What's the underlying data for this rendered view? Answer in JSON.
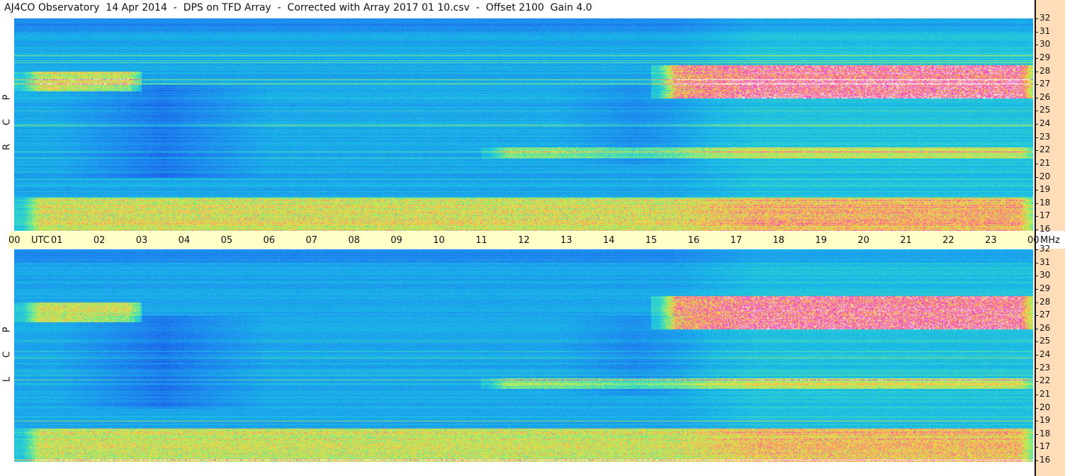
{
  "title": "AJ4CO Observatory  14 Apr 2014  -  DPS on TFD Array  -  Corrected with Array 2017 01 10.csv  -  Offset 2100  Gain 4.0",
  "chart_data": [
    {
      "type": "heatmap",
      "title": "AJ4CO Observatory  14 Apr 2014  -  DPS on TFD Array  -  Corrected with Array 2017 01 10.csv  -  Offset 2100  Gain 4.0",
      "ylabel": [
        "R",
        "C",
        "P"
      ],
      "xlabel": "UTC",
      "x_tick_labels": [
        "00",
        "01",
        "02",
        "03",
        "04",
        "05",
        "06",
        "07",
        "08",
        "09",
        "10",
        "11",
        "12",
        "13",
        "14",
        "15",
        "16",
        "17",
        "18",
        "19",
        "20",
        "21",
        "22",
        "23",
        "00"
      ],
      "x_unit_label": "UTC",
      "x_range_hours": [
        0,
        24
      ],
      "y_unit_label": "MHz",
      "y_tick_labels": [
        "32",
        "31",
        "30",
        "29",
        "28",
        "27",
        "26",
        "25",
        "24",
        "23",
        "22",
        "21",
        "20",
        "19",
        "18",
        "17",
        "16"
      ],
      "y_range_mhz": [
        16,
        32
      ],
      "colormap": [
        "#1a3fd9",
        "#1f88f0",
        "#19c4e6",
        "#4de0b0",
        "#b8f060",
        "#ffd040",
        "#ff6a8a",
        "#e030e0",
        "#ffffff"
      ],
      "features": [
        {
          "band_mhz": [
            26.5,
            28.0
          ],
          "hours": [
            0,
            3
          ],
          "intensity": "high"
        },
        {
          "band_mhz": [
            26.0,
            28.5
          ],
          "hours": [
            15,
            24
          ],
          "intensity": "very high"
        },
        {
          "band_mhz": [
            16.0,
            18.5
          ],
          "hours": [
            0,
            24
          ],
          "intensity": "high"
        },
        {
          "band_mhz": [
            21.5,
            22.3
          ],
          "hours": [
            11,
            24
          ],
          "intensity": "medium"
        }
      ]
    },
    {
      "type": "heatmap",
      "ylabel": [
        "L",
        "C",
        "P"
      ],
      "xlabel": "UTC",
      "x_range_hours": [
        0,
        24
      ],
      "y_unit_label": "MHz",
      "y_tick_labels": [
        "32",
        "31",
        "30",
        "29",
        "28",
        "27",
        "26",
        "25",
        "24",
        "23",
        "22",
        "21",
        "20",
        "19",
        "18",
        "17",
        "16"
      ],
      "y_range_mhz": [
        16,
        32
      ],
      "features": [
        {
          "band_mhz": [
            26.5,
            28.0
          ],
          "hours": [
            0,
            3
          ],
          "intensity": "high"
        },
        {
          "band_mhz": [
            26.0,
            28.5
          ],
          "hours": [
            15,
            24
          ],
          "intensity": "very high"
        },
        {
          "band_mhz": [
            16.0,
            18.5
          ],
          "hours": [
            0,
            24
          ],
          "intensity": "high"
        },
        {
          "band_mhz": [
            21.5,
            22.3
          ],
          "hours": [
            11,
            24
          ],
          "intensity": "medium"
        }
      ]
    }
  ],
  "pol_rcp": [
    "R",
    "C",
    "P"
  ],
  "pol_lcp": [
    "L",
    "C",
    "P"
  ]
}
